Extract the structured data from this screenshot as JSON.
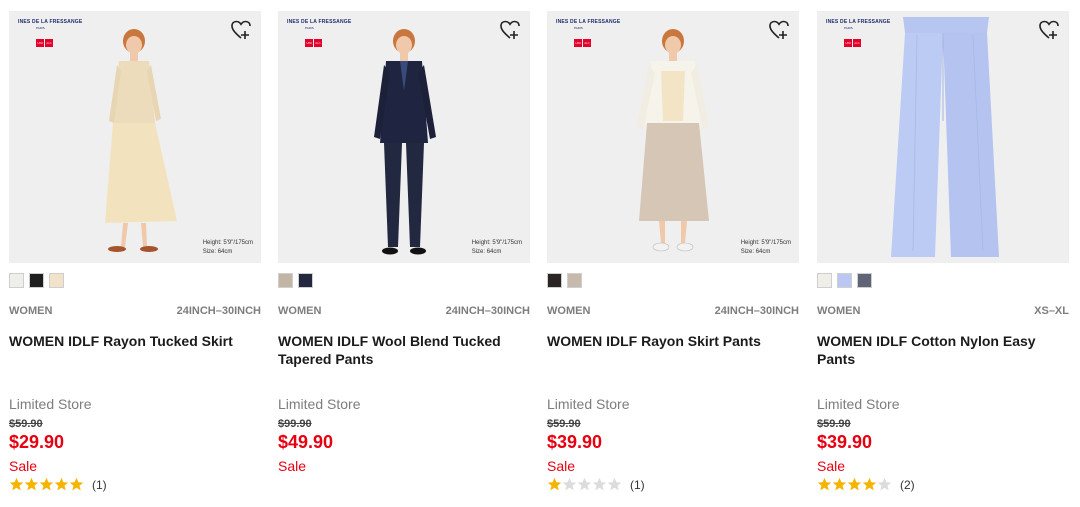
{
  "colors": {
    "price_red": "#e60012",
    "star_filled": "#f5b400",
    "star_empty": "#dcdcdc",
    "image_bg": "#efefef",
    "muted_text": "#7d7d7d"
  },
  "products": [
    {
      "brand_text": "INES DE LA FRESSANGE",
      "wishlist_icon": "heart-plus-icon",
      "model_info": [
        "Height: 5'9\"/175cm",
        "Size: 64cm"
      ],
      "swatch_colors": [
        "#eeeeea",
        "#1f1f1f",
        "#f1e3c9"
      ],
      "gender": "WOMEN",
      "sizes": "24INCH–30INCH",
      "name": "WOMEN IDLF Rayon Tucked Skirt",
      "store": "Limited Store",
      "original_price": "$59.90",
      "price": "$29.90",
      "sale": "Sale",
      "rating": 5,
      "review_count": "(1)"
    },
    {
      "brand_text": "INES DE LA FRESSANGE",
      "wishlist_icon": "heart-plus-icon",
      "model_info": [
        "Height: 5'9\"/175cm",
        "Size: 64cm"
      ],
      "swatch_colors": [
        "#c3b5a5",
        "#23283f"
      ],
      "gender": "WOMEN",
      "sizes": "24INCH–30INCH",
      "name": "WOMEN IDLF Wool Blend Tucked Tapered Pants",
      "store": "Limited Store",
      "original_price": "$99.90",
      "price": "$49.90",
      "sale": "Sale",
      "rating": null,
      "review_count": ""
    },
    {
      "brand_text": "INES DE LA FRESSANGE",
      "wishlist_icon": "heart-plus-icon",
      "model_info": [
        "Height: 5'9\"/175cm",
        "Size: 64cm"
      ],
      "swatch_colors": [
        "#2b2424",
        "#c8b9ad"
      ],
      "gender": "WOMEN",
      "sizes": "24INCH–30INCH",
      "name": "WOMEN IDLF Rayon Skirt Pants",
      "store": "Limited Store",
      "original_price": "$59.90",
      "price": "$39.90",
      "sale": "Sale",
      "rating": 1,
      "review_count": "(1)"
    },
    {
      "brand_text": "INES DE LA FRESSANGE",
      "wishlist_icon": "heart-plus-icon",
      "model_info": [],
      "swatch_colors": [
        "#f0eee8",
        "#b9c7f2",
        "#5f6577"
      ],
      "gender": "WOMEN",
      "sizes": "XS–XL",
      "name": "WOMEN IDLF Cotton Nylon Easy Pants",
      "store": "Limited Store",
      "original_price": "$59.90",
      "price": "$39.90",
      "sale": "Sale",
      "rating": 4,
      "review_count": "(2)"
    }
  ]
}
